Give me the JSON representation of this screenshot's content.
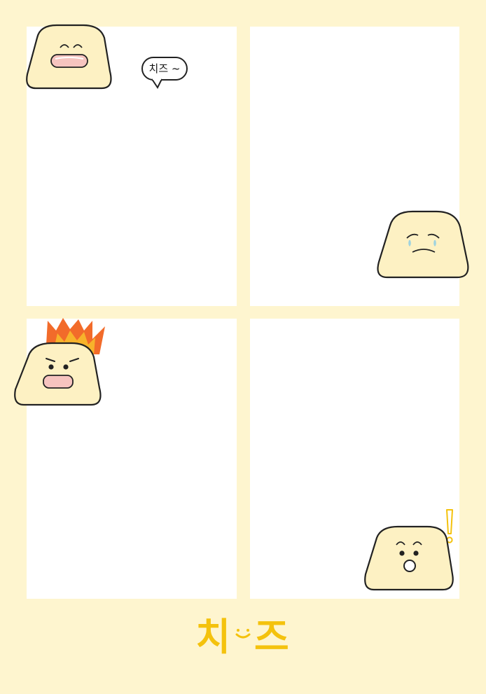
{
  "speech_bubble": {
    "text": "치즈 ~"
  },
  "logo": {
    "left_text": "치",
    "right_text": "즈"
  },
  "colors": {
    "background": "#fef5cf",
    "panel": "#ffffff",
    "character_fill": "#fdf1c3",
    "outline": "#222222",
    "logo": "#f4c20d",
    "flame_outer": "#f26b2a",
    "flame_inner": "#f7b32b",
    "tear": "#9fd3e0",
    "mouth_pink": "#f6c4bf"
  },
  "characters": [
    {
      "panel": 1,
      "expression": "laughing"
    },
    {
      "panel": 2,
      "expression": "crying"
    },
    {
      "panel": 3,
      "expression": "angry-on-fire"
    },
    {
      "panel": 4,
      "expression": "surprised-exclamation"
    }
  ]
}
